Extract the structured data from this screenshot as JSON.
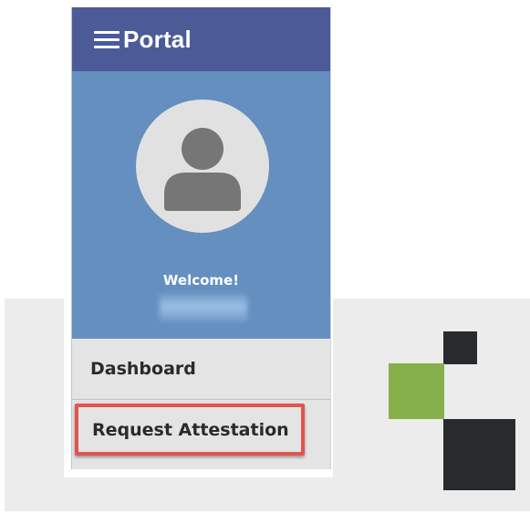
{
  "header": {
    "menu_icon": "hamburger-menu-icon",
    "title": "Portal"
  },
  "profile": {
    "avatar_icon": "user-avatar-icon",
    "welcome_text": "Welcome!",
    "user_name_redacted": true
  },
  "nav": {
    "items": [
      {
        "label": "Dashboard",
        "highlighted": false
      },
      {
        "label": "Request Attestation",
        "highlighted": true
      }
    ]
  },
  "logo": {
    "icon": "squares-logo-icon",
    "colors": {
      "dark": "#282b2e",
      "green": "#86b04a"
    }
  },
  "colors": {
    "header_bg": "#4c5b98",
    "profile_bg": "#648fbf",
    "highlight_border": "#e0564e"
  }
}
